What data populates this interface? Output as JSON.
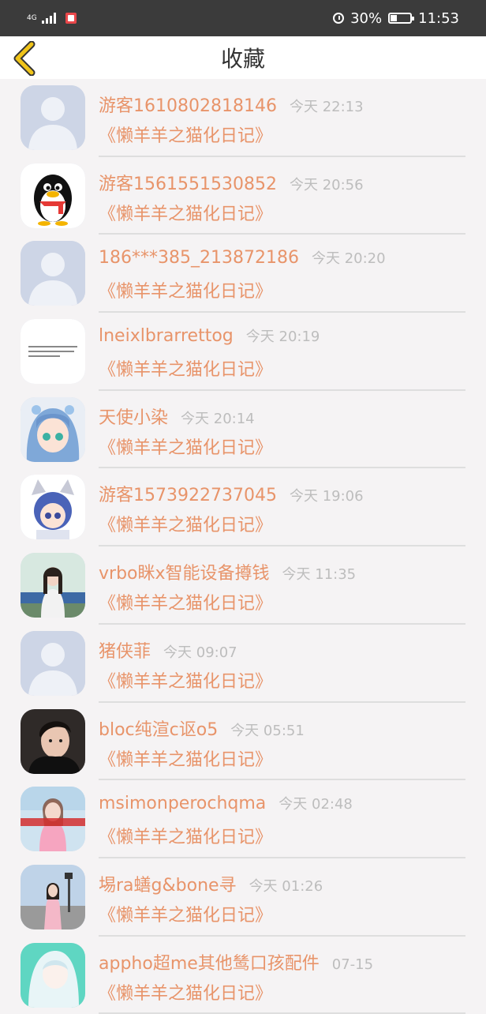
{
  "status_bar": {
    "network": "4G",
    "battery_percent": "30%",
    "time": "11:53"
  },
  "header": {
    "title": "收藏",
    "back_icon": "chevron-left-icon",
    "accent_color": "#f0c419"
  },
  "colors": {
    "name": "#e8946a",
    "time": "#bdbdbd",
    "background": "#f5f3f4"
  },
  "items": [
    {
      "name": "游客1610802818146",
      "time": "今天 22:13",
      "title": "《懒羊羊之猫化日记》",
      "avatar": "default"
    },
    {
      "name": "游客1561551530852",
      "time": "今天 20:56",
      "title": "《懒羊羊之猫化日记》",
      "avatar": "penguin"
    },
    {
      "name": "186***385_213872186",
      "time": "今天 20:20",
      "title": "《懒羊羊之猫化日记》",
      "avatar": "default"
    },
    {
      "name": "lneixlbrarrettog",
      "time": "今天 20:19",
      "title": "《懒羊羊之猫化日记》",
      "avatar": "text"
    },
    {
      "name": "天使小染",
      "time": "今天 20:14",
      "title": "《懒羊羊之猫化日记》",
      "avatar": "anime-blue"
    },
    {
      "name": "游客1573922737045",
      "time": "今天 19:06",
      "title": "《懒羊羊之猫化日记》",
      "avatar": "anime-cat"
    },
    {
      "name": "vrbo眯x智能设备撙钱",
      "time": "今天 11:35",
      "title": "《懒羊羊之猫化日记》",
      "avatar": "photo-girl"
    },
    {
      "name": "猪侠菲",
      "time": "今天 09:07",
      "title": "《懒羊羊之猫化日记》",
      "avatar": "default"
    },
    {
      "name": "bloc纯渲c讴o5",
      "time": "今天 05:51",
      "title": "《懒羊羊之猫化日记》",
      "avatar": "photo-boy"
    },
    {
      "name": "msimonperochqma",
      "time": "今天 02:48",
      "title": "《懒羊羊之猫化日记》",
      "avatar": "photo-pink"
    },
    {
      "name": "埸ra蟮g&bone寻",
      "time": "今天 01:26",
      "title": "《懒羊羊之猫化日记》",
      "avatar": "photo-street"
    },
    {
      "name": "appho超me其他鸶口孩配件",
      "time": "07-15",
      "title": "《懒羊羊之猫化日记》",
      "avatar": "anime-teal"
    }
  ]
}
